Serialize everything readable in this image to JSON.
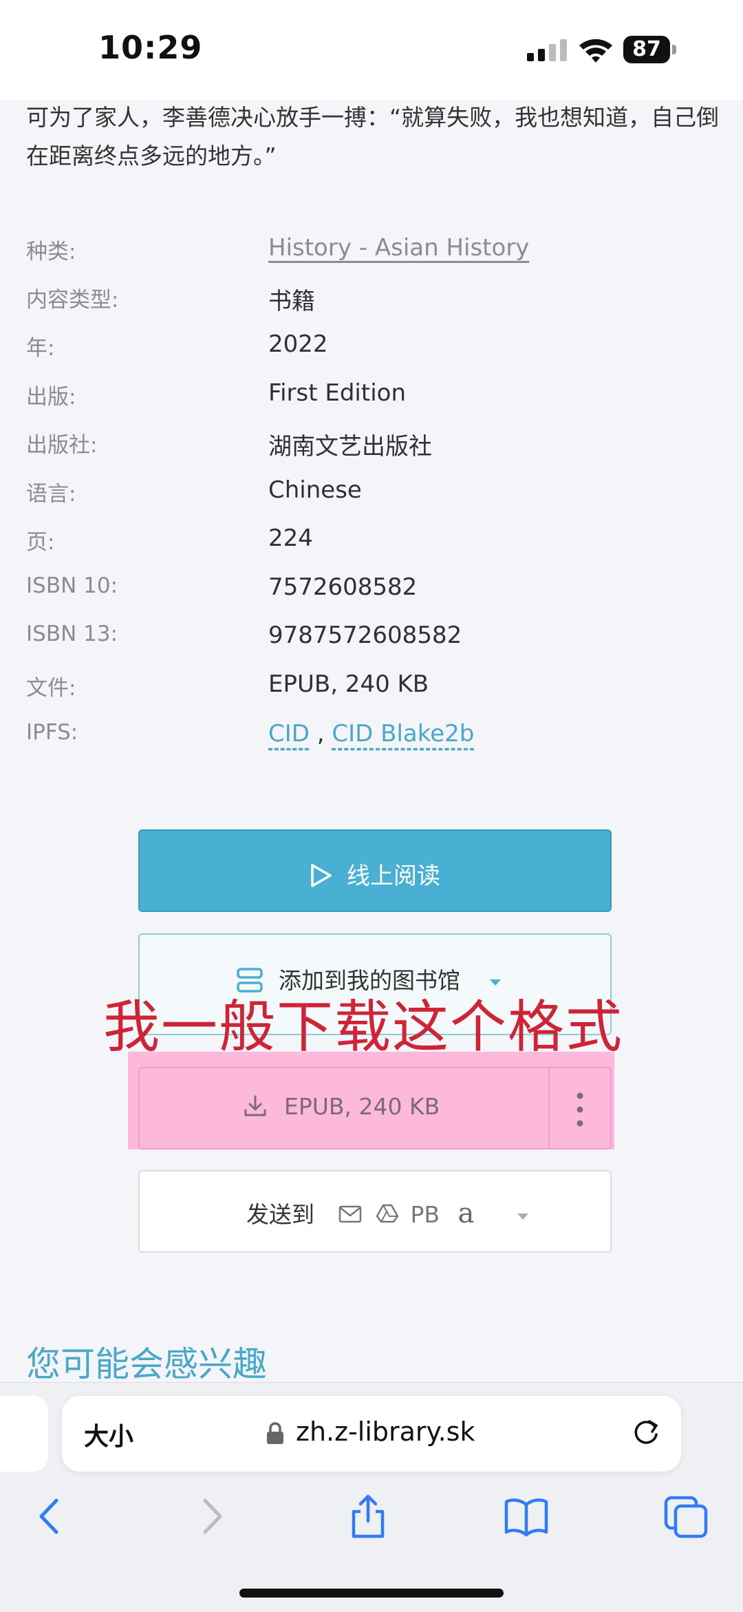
{
  "status_bar": {
    "time": "10:29",
    "battery": "87"
  },
  "description": "可为了家人，李善德决心放手一搏：“就算失败，我也想知道，自己倒在距离终点多远的地方。”",
  "details": [
    {
      "label": "种类:",
      "value": "History - Asian History"
    },
    {
      "label": "内容类型:",
      "value": "书籍"
    },
    {
      "label": "年:",
      "value": "2022"
    },
    {
      "label": "出版:",
      "value": "First Edition"
    },
    {
      "label": "出版社:",
      "value": "湖南文艺出版社"
    },
    {
      "label": "语言:",
      "value": "Chinese"
    },
    {
      "label": "页:",
      "value": "224"
    },
    {
      "label": "ISBN 10:",
      "value": "7572608582"
    },
    {
      "label": "ISBN 13:",
      "value": "9787572608582"
    },
    {
      "label": "文件:",
      "value": "EPUB, 240 KB"
    },
    {
      "label": "IPFS:",
      "links": [
        "CID",
        "CID Blake2b"
      ],
      "separator": " , "
    }
  ],
  "actions": {
    "read_online": "线上阅读",
    "add_to_library": "添加到我的图书馆",
    "download": "EPUB, 240 KB",
    "send_to": "发送到",
    "send_targets": [
      "PB",
      "a"
    ]
  },
  "annotation": "我一般下载这个格式",
  "section_title": "您可能会感兴趣",
  "browser": {
    "text_size": "大小",
    "url": "zh.z-library.sk"
  },
  "colors": {
    "accent": "#49b0d3",
    "highlight": "#fdb9dc",
    "annotation": "#cf2336",
    "link": "#49a8c9"
  }
}
